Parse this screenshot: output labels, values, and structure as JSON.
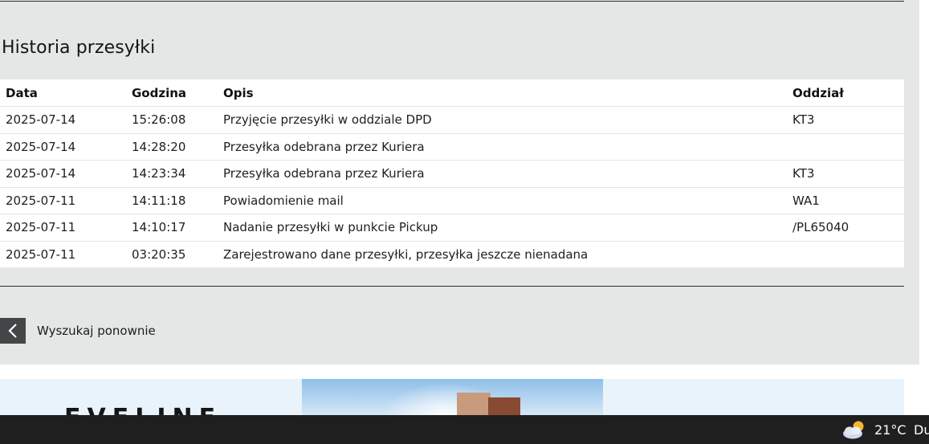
{
  "section_title": "Historia przesyłki",
  "table": {
    "headers": {
      "date": "Data",
      "time": "Godzina",
      "description": "Opis",
      "branch": "Oddział"
    },
    "rows": [
      {
        "date": "2025-07-14",
        "time": "15:26:08",
        "description": "Przyjęcie przesyłki w oddziale DPD",
        "branch": "KT3"
      },
      {
        "date": "2025-07-14",
        "time": "14:28:20",
        "description": "Przesyłka odebrana przez Kuriera",
        "branch": ""
      },
      {
        "date": "2025-07-14",
        "time": "14:23:34",
        "description": "Przesyłka odebrana przez Kuriera",
        "branch": "KT3"
      },
      {
        "date": "2025-07-11",
        "time": "14:11:18",
        "description": "Powiadomienie mail",
        "branch": "WA1"
      },
      {
        "date": "2025-07-11",
        "time": "14:10:17",
        "description": "Nadanie przesyłki w punkcie Pickup",
        "branch": "/PL65040"
      },
      {
        "date": "2025-07-11",
        "time": "03:20:35",
        "description": "Zarejestrowano dane przesyłki, przesyłka jeszcze nienadana",
        "branch": ""
      }
    ]
  },
  "back_button": {
    "label": "Wyszukaj ponownie",
    "icon": "chevron-left-icon"
  },
  "banner": {
    "brand": "EVELINE"
  },
  "taskbar": {
    "weather": {
      "icon": "partly-cloudy-icon",
      "temperature": "21°C",
      "description": "Du"
    }
  },
  "colors": {
    "panel_background": "#e4e7e6",
    "back_button_background": "#434547",
    "taskbar_background": "#1f1f1f"
  }
}
